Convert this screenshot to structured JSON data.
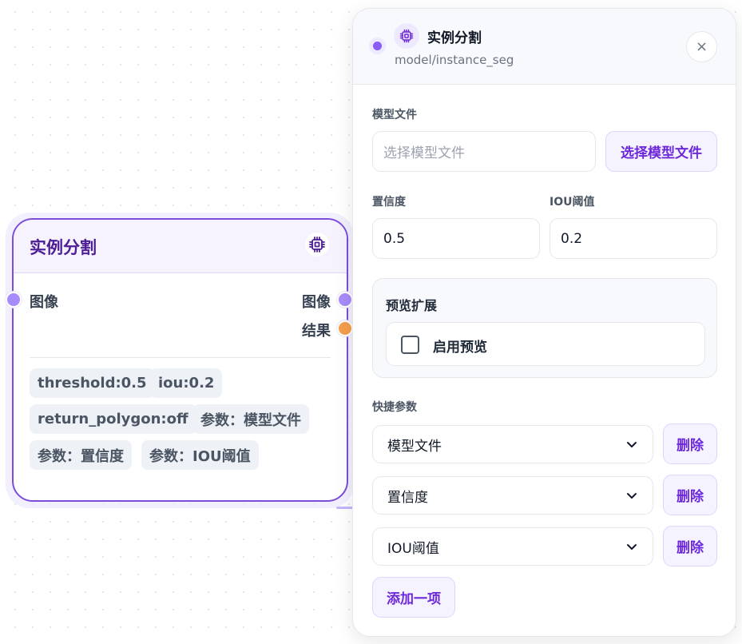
{
  "node": {
    "title": "实例分割",
    "input_port": "图像",
    "output_ports": [
      "图像",
      "结果"
    ],
    "tags": [
      "threshold:0.5",
      "iou:0.2",
      "return_polygon:off",
      "参数：模型文件",
      "参数：置信度",
      "参数：IOU阈值"
    ]
  },
  "panel": {
    "title": "实例分割",
    "subtitle": "model/instance_seg",
    "close_icon": "×",
    "model_file": {
      "label": "模型文件",
      "placeholder": "选择模型文件",
      "button": "选择模型文件"
    },
    "confidence": {
      "label": "置信度",
      "value": "0.5"
    },
    "iou": {
      "label": "IOU阈值",
      "value": "0.2"
    },
    "preview": {
      "title": "预览扩展",
      "checkbox_label": "启用预览",
      "checked": false
    },
    "quick_params": {
      "label": "快捷参数",
      "items": [
        {
          "value": "模型文件",
          "delete": "删除"
        },
        {
          "value": "置信度",
          "delete": "删除"
        },
        {
          "value": "IOU阈值",
          "delete": "删除"
        }
      ],
      "add_button": "添加一项"
    }
  },
  "colors": {
    "accent": "#7c4ddb",
    "accent_soft": "#f5f3ff",
    "port_purple": "#a78bfa",
    "port_orange": "#f59e4b"
  },
  "icons": {
    "chip": "cpu-chip-icon",
    "close": "close-icon",
    "chevron": "chevron-down-icon"
  }
}
